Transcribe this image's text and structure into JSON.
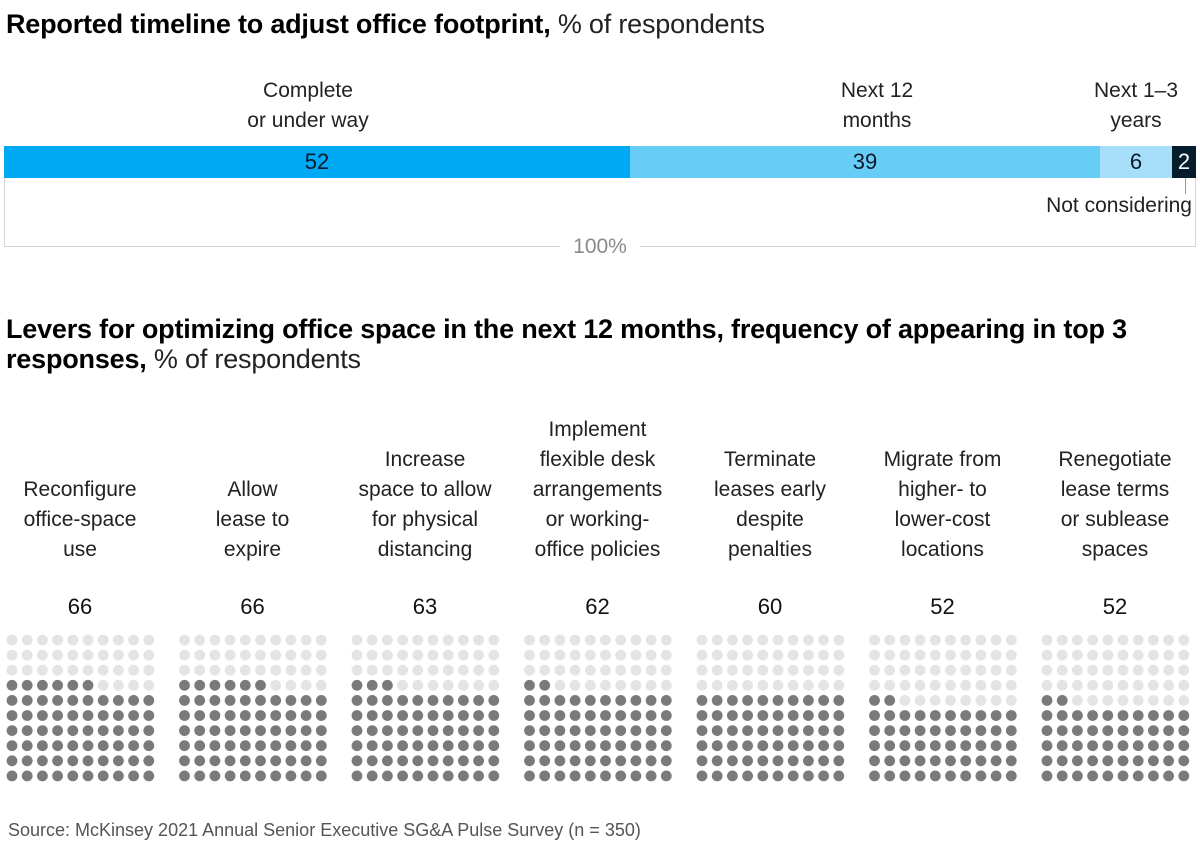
{
  "chart_data": [
    {
      "type": "bar",
      "subtype": "stacked-horizontal-100",
      "title": "Reported timeline to adjust office footprint,",
      "title_unit": "% of respondents",
      "categories": [
        "Complete or under way",
        "Next 12 months",
        "Next 1–3 years",
        "Not considering"
      ],
      "category_labels": [
        "Complete\nor under way",
        "Next 12\nmonths",
        "Next 1–3\nyears",
        "Not considering"
      ],
      "values": [
        52,
        39,
        6,
        2
      ],
      "colors": [
        "#00a9f4",
        "#67ccf6",
        "#a7dffa",
        "#051c2c"
      ],
      "total_label": "100%"
    },
    {
      "type": "waffle",
      "title": "Levers for optimizing office space in the next 12 months, frequency of appearing in top 3 responses,",
      "title_unit": "% of respondents",
      "grid": "10x10",
      "filled_color": "#7a7a7a",
      "empty_color": "#e4e4e4",
      "categories": [
        "Reconfigure\noffice-space\nuse",
        "Allow\nlease to\nexpire",
        "Increase\nspace to allow\nfor physical\ndistancing",
        "Implement\nflexible desk\narrangements\nor working-\noffice policies",
        "Terminate\nleases early\ndespite\npenalties",
        "Migrate from\nhigher- to\nlower-cost\nlocations",
        "Renegotiate\nlease terms\nor sublease\nspaces"
      ],
      "values": [
        66,
        66,
        63,
        62,
        60,
        52,
        52
      ]
    }
  ],
  "source": "Source: McKinsey 2021 Annual Senior Executive SG&A Pulse Survey (n = 350)"
}
